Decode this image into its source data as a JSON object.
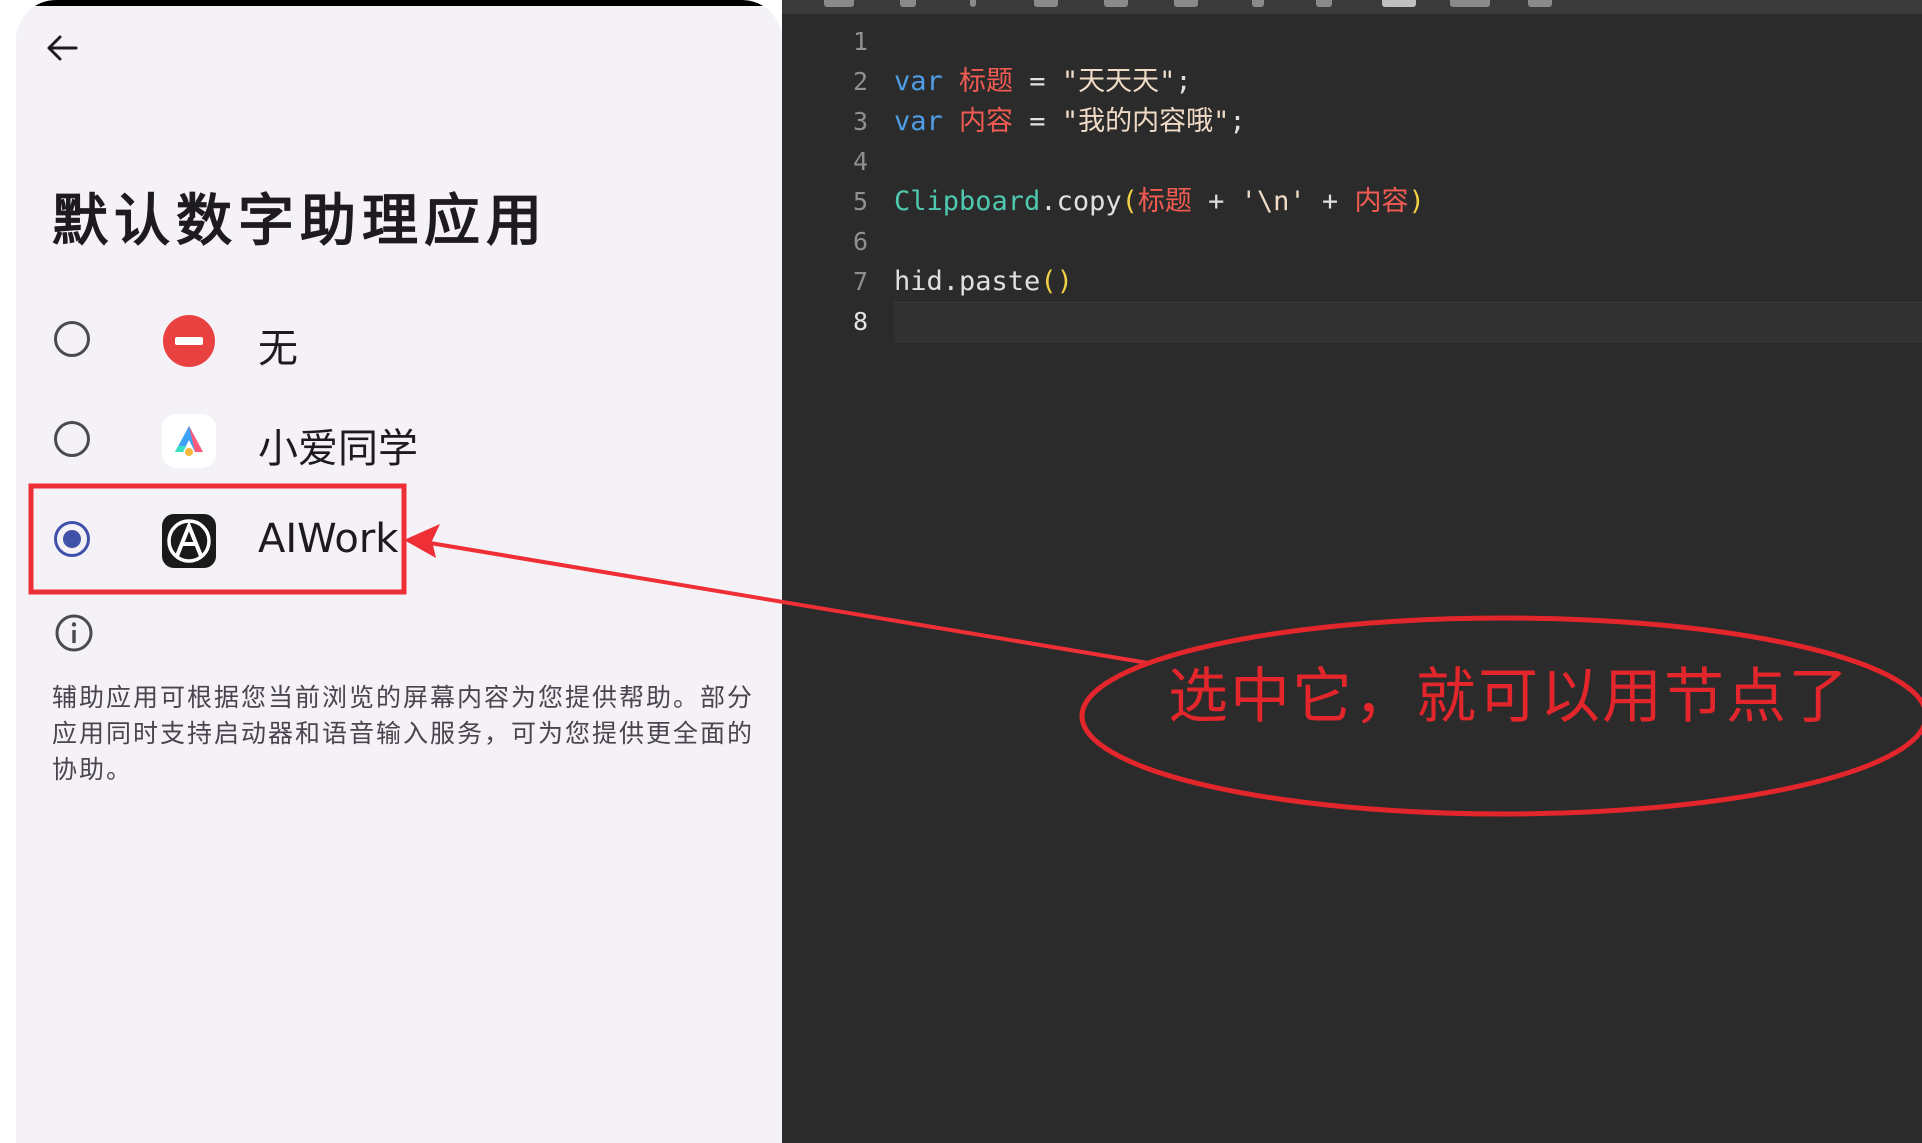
{
  "settings": {
    "title": "默认数字助理应用",
    "options": [
      {
        "label": "无",
        "selected": false,
        "icon": "none-icon"
      },
      {
        "label": "小爱同学",
        "selected": false,
        "icon": "xiaoai-icon"
      },
      {
        "label": "AIWork",
        "selected": true,
        "icon": "aiwork-icon"
      }
    ],
    "description": "辅助应用可根据您当前浏览的屏幕内容为您提供帮助。部分应用同时支持启动器和语音输入服务，可为您提供更全面的协助。"
  },
  "editor": {
    "line_numbers": [
      "1",
      "2",
      "3",
      "4",
      "5",
      "6",
      "7",
      "8"
    ],
    "current_line": "8",
    "code": {
      "l2": {
        "kw": "var",
        "name": "标题",
        "eq": " = ",
        "str": "\"天天天\"",
        "end": ";"
      },
      "l3": {
        "kw": "var",
        "name": "内容",
        "eq": " = ",
        "str": "\"我的内容哦\"",
        "end": ";"
      },
      "l5": {
        "obj": "Clipboard",
        "method": ".copy",
        "open": "(",
        "a": "标题",
        "op1": " + ",
        "nl": "'\\n'",
        "op2": " + ",
        "b": "内容",
        "close": ")"
      },
      "l7": {
        "call": "hid.paste",
        "parens": "()"
      }
    }
  },
  "annotation": {
    "text": "选中它，就可以用节点了",
    "color": "#e3262b"
  },
  "colors": {
    "keyword": "#4e9ee8",
    "variable": "#f25b52",
    "function": "#4ec9b0",
    "paren": "#f2d046",
    "editor_bg": "#2b2b2b",
    "panel_bg": "#f4f1f7",
    "radio_selected": "#3f51a8"
  }
}
